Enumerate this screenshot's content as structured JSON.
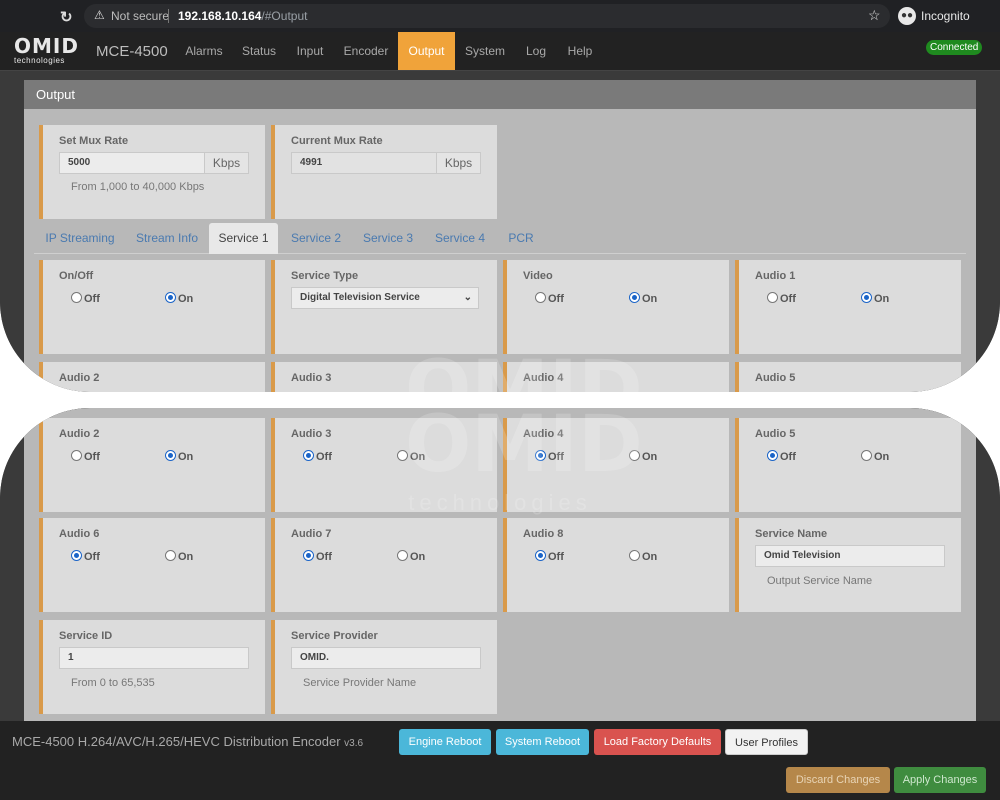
{
  "browser": {
    "security_label": "Not secure",
    "url_host": "192.168.10.164",
    "url_path": "/#Output",
    "profile_label": "Incognito"
  },
  "app": {
    "logo_main": "OMID",
    "logo_sub": "technologies",
    "model": "MCE-4500",
    "nav": [
      "Alarms",
      "Status",
      "Input",
      "Encoder",
      "Output",
      "System",
      "Log",
      "Help"
    ],
    "active_nav": "Output",
    "connection_status": "Connected",
    "accent_color": "#f0a33a",
    "status_color": "#1f8a1f"
  },
  "panel": {
    "title": "Output",
    "set_mux_rate": {
      "label": "Set Mux Rate",
      "value": "5000",
      "unit": "Kbps",
      "help": "From 1,000 to 40,000 Kbps"
    },
    "current_mux_rate": {
      "label": "Current Mux Rate",
      "value": "4991",
      "unit": "Kbps"
    },
    "tabs": [
      "IP Streaming",
      "Stream Info",
      "Service 1",
      "Service 2",
      "Service 3",
      "Service 4",
      "PCR"
    ],
    "active_tab": "Service 1"
  },
  "service": {
    "off_label": "Off",
    "on_label": "On",
    "toggles": [
      {
        "label": "On/Off",
        "value": "On"
      },
      {
        "label": "Video",
        "value": "On"
      },
      {
        "label": "Audio 1",
        "value": "On"
      },
      {
        "label": "Audio 2",
        "value": "On"
      },
      {
        "label": "Audio 3",
        "value": "Off"
      },
      {
        "label": "Audio 4",
        "value": "Off"
      },
      {
        "label": "Audio 5",
        "value": "Off"
      },
      {
        "label": "Audio 6",
        "value": "Off"
      },
      {
        "label": "Audio 7",
        "value": "Off"
      },
      {
        "label": "Audio 8",
        "value": "Off"
      }
    ],
    "service_type": {
      "label": "Service Type",
      "value": "Digital Television Service"
    },
    "service_name": {
      "label": "Service Name",
      "value": "Omid Television",
      "help": "Output Service Name"
    },
    "service_id": {
      "label": "Service ID",
      "value": "1",
      "help": "From 0 to 65,535"
    },
    "service_provider": {
      "label": "Service Provider",
      "value": "OMID.",
      "help": "Service Provider Name"
    }
  },
  "watermark": {
    "main": "OMID",
    "sub": "technologies"
  },
  "footer": {
    "product": "MCE-4500 H.264/AVC/H.265/HEVC Distribution Encoder",
    "version": "v3.6",
    "buttons": {
      "engine_reboot": "Engine Reboot",
      "system_reboot": "System Reboot",
      "load_defaults": "Load Factory Defaults",
      "user_profiles": "User Profiles",
      "discard": "Discard Changes",
      "apply": "Apply Changes"
    }
  }
}
